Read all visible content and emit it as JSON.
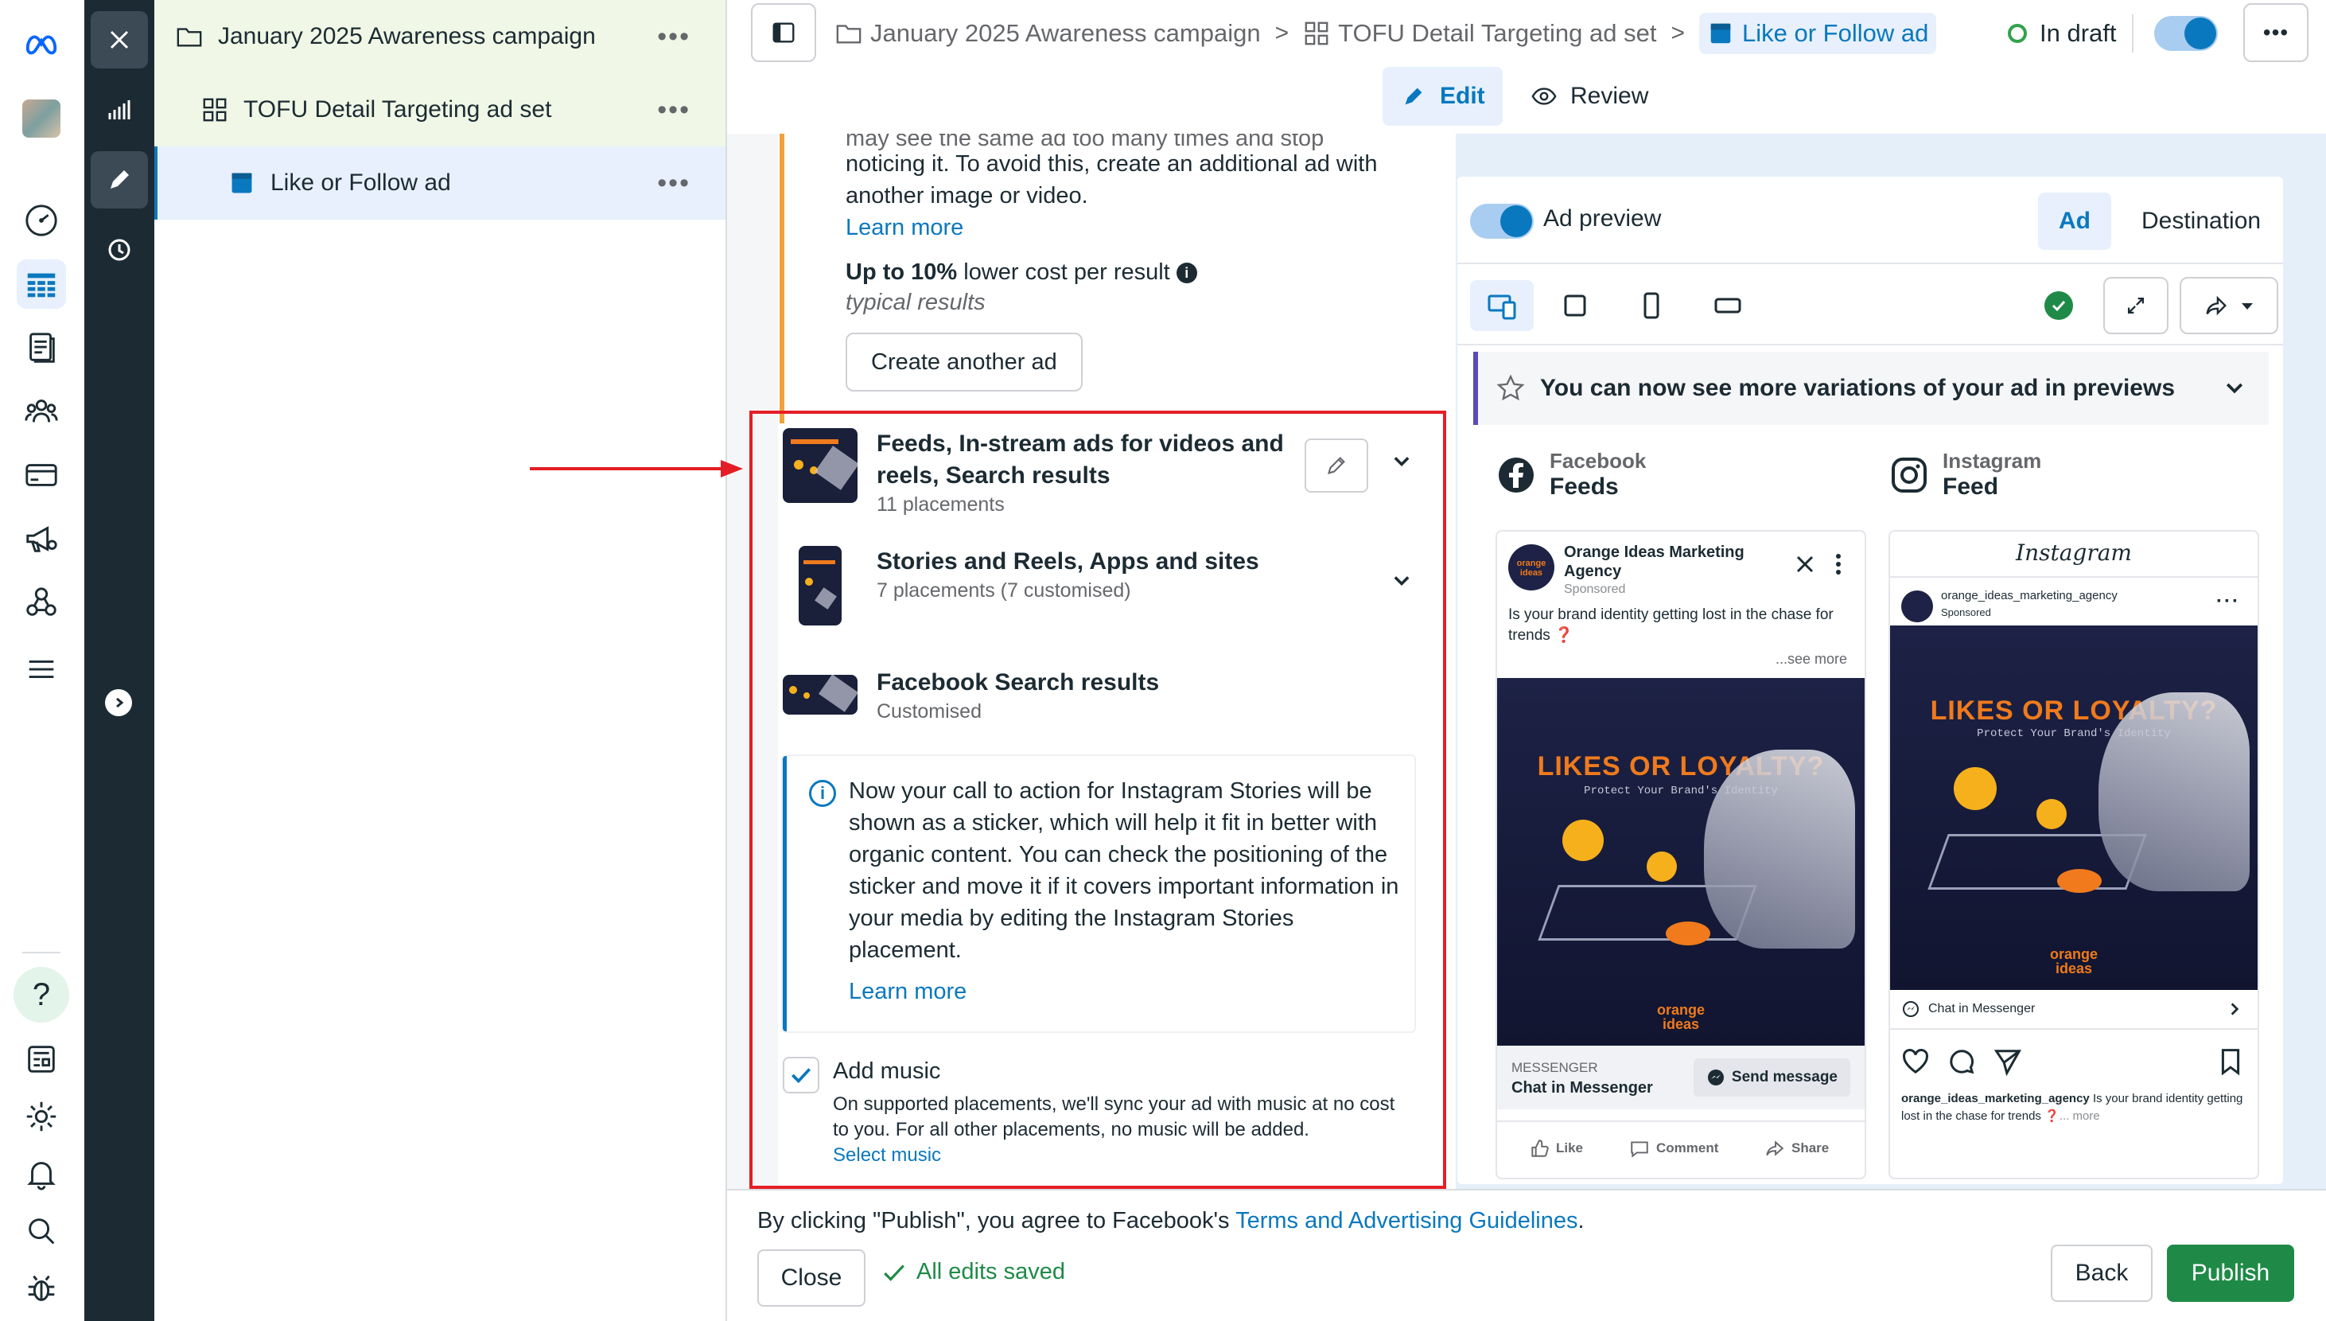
{
  "tree": {
    "campaign": "January 2025 Awareness campaign",
    "adset": "TOFU Detail Targeting ad set",
    "ad": "Like or Follow ad",
    "more": "•••"
  },
  "header": {
    "breadcrumb": [
      "January 2025 Awareness campaign",
      "TOFU Detail Targeting ad set",
      "Like or Follow ad"
    ],
    "status": "In draft",
    "more": "•••",
    "sep": ">",
    "modes": {
      "edit": "Edit",
      "review": "Review"
    }
  },
  "tip": {
    "text": "noticing it. To avoid this, create an additional ad with another image or video.",
    "cut_line": "may see the same ad too many times and stop",
    "learn_more": "Learn more",
    "savings_bold": "Up to 10%",
    "savings_rest": "lower cost per result",
    "typical": "typical results",
    "create_btn": "Create another ad"
  },
  "placements": [
    {
      "title": "Feeds, In-stream ads for videos and reels, Search results",
      "sub": "11 placements"
    },
    {
      "title": "Stories and Reels, Apps and sites",
      "sub": "7 placements (7 customised)"
    },
    {
      "title": "Facebook Search results",
      "sub": "Customised"
    }
  ],
  "info": {
    "text": "Now your call to action for Instagram Stories will be shown as a sticker, which will help it fit in better with organic content. You can check the positioning of the sticker and move it if it covers important information in your media by editing the Instagram Stories placement.",
    "learn_more": "Learn more"
  },
  "music": {
    "title": "Add music",
    "desc": "On supported placements, we'll sync your ad with music at no cost to you. For all other placements, no music will be added.",
    "link": "Select music",
    "checked": true
  },
  "preview": {
    "toggle_label": "Ad preview",
    "tab_ad": "Ad",
    "tab_destination": "Destination",
    "banner": "You can now see more variations of your ad in previews",
    "fb": {
      "platform": "Facebook",
      "placement": "Feeds",
      "page_name": "Orange Ideas Marketing Agency",
      "sponsored": "Sponsored",
      "caption": "Is your brand identity getting lost in the chase for trends",
      "caption_emoji": "❓",
      "see_more": "...see more",
      "cta_kicker": "MESSENGER",
      "cta_title": "Chat in Messenger",
      "cta_btn": "Send message",
      "actions": [
        "Like",
        "Comment",
        "Share"
      ]
    },
    "ig": {
      "platform": "Instagram",
      "placement": "Feed",
      "wordmark": "Instagram",
      "account": "orange_ideas_marketing_agency",
      "sponsored": "Sponsored",
      "cta": "Chat in Messenger",
      "caption_handle": "orange_ideas_marketing_agency",
      "caption": "Is your brand identity getting lost in the chase for trends",
      "caption_tail": "❓... more"
    },
    "creative": {
      "headline": "LIKES OR LOYALTY?",
      "tagline": "Protect Your Brand's Identity",
      "logo_top": "orange",
      "logo_bottom": "ideas"
    }
  },
  "footer": {
    "terms_prefix": "By clicking \"Publish\", you agree to Facebook's",
    "terms_link": "Terms and Advertising Guidelines",
    "terms_suffix": ".",
    "close": "Close",
    "saved": "All edits saved",
    "back": "Back",
    "publish": "Publish"
  },
  "colors": {
    "accent": "#0a78be",
    "publish": "#1f8a47",
    "highlight_box": "#e41e26",
    "draft_ring": "#31a24c"
  }
}
